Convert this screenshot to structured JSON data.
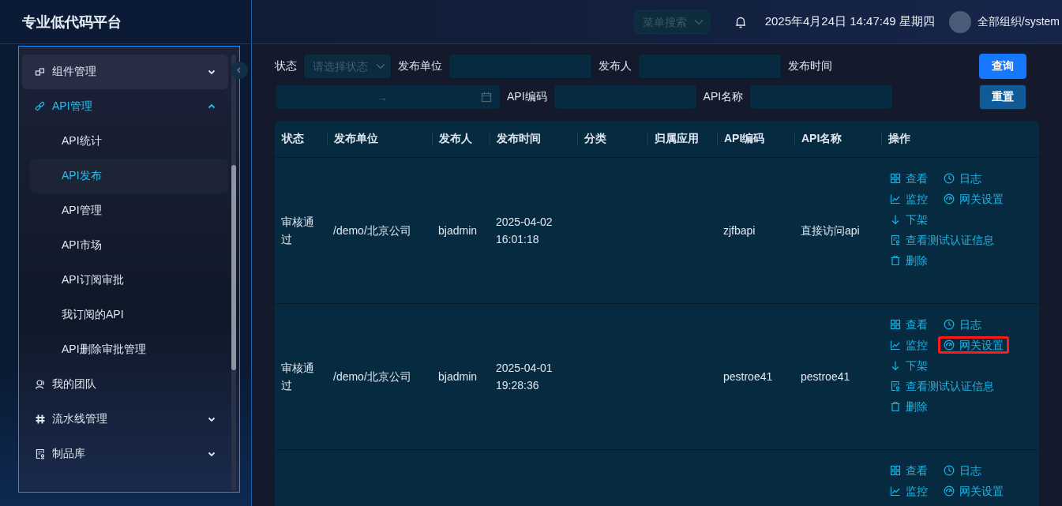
{
  "header": {
    "title": "专业低代码平台",
    "menu_search": {
      "placeholder": "菜单搜索"
    },
    "datetime": "2025年4月24日 14:47:49 星期四",
    "user": "全部组织/system"
  },
  "sidebar": {
    "items": [
      {
        "label": "组件管理",
        "kind": "group",
        "expanded": false,
        "selected": false
      },
      {
        "label": "API管理",
        "kind": "group",
        "expanded": true,
        "selected": true,
        "children": [
          {
            "label": "API统计",
            "selected": false
          },
          {
            "label": "API发布",
            "selected": true
          },
          {
            "label": "API管理",
            "selected": false
          },
          {
            "label": "API市场",
            "selected": false
          },
          {
            "label": "API订阅审批",
            "selected": false
          },
          {
            "label": "我订阅的API",
            "selected": false
          },
          {
            "label": "API删除审批管理",
            "selected": false
          }
        ]
      },
      {
        "label": "我的团队",
        "kind": "link",
        "selected": false
      },
      {
        "label": "流水线管理",
        "kind": "group",
        "expanded": false,
        "selected": false
      },
      {
        "label": "制品库",
        "kind": "group",
        "expanded": false,
        "selected": false
      }
    ]
  },
  "filters": [
    {
      "kind": "select",
      "label": "状态",
      "placeholder": "请选择状态"
    },
    {
      "kind": "input",
      "label": "发布单位"
    },
    {
      "kind": "input",
      "label": "发布人"
    },
    {
      "kind": "daterange",
      "label": "发布时间",
      "separator": "→"
    },
    {
      "kind": "input",
      "label": "API编码"
    },
    {
      "kind": "input",
      "label": "API名称"
    }
  ],
  "buttons": [
    {
      "label": "查询",
      "kind": "primary"
    },
    {
      "label": "重置",
      "kind": "secondary"
    }
  ],
  "table": {
    "columns": [
      "状态",
      "发布单位",
      "发布人",
      "发布时间",
      "分类",
      "归属应用",
      "API编码",
      "API名称",
      "操作"
    ],
    "rows": [
      {
        "cells": [
          "审核通过",
          "/demo/北京公司",
          "bjadmin",
          "2025-04-02 16:01:18",
          "",
          "",
          "zjfbapi",
          "直接访问api"
        ],
        "actions": [
          [
            {
              "kind": "view",
              "label": "查看",
              "highlighted": false
            },
            {
              "kind": "log",
              "label": "日志",
              "highlighted": false
            }
          ],
          [
            {
              "kind": "monitor",
              "label": "监控",
              "highlighted": false
            },
            {
              "kind": "gateway",
              "label": "网关设置",
              "highlighted": false
            }
          ],
          [
            {
              "kind": "offline",
              "label": "下架",
              "highlighted": false
            }
          ],
          [
            {
              "kind": "auth",
              "label": "查看测试认证信息",
              "highlighted": false
            }
          ],
          [
            {
              "kind": "delete",
              "label": "删除",
              "highlighted": false
            }
          ]
        ]
      },
      {
        "cells": [
          "审核通过",
          "/demo/北京公司",
          "bjadmin",
          "2025-04-01 19:28:36",
          "",
          "",
          "pestroe41",
          "pestroe41"
        ],
        "actions": [
          [
            {
              "kind": "view",
              "label": "查看",
              "highlighted": false
            },
            {
              "kind": "log",
              "label": "日志",
              "highlighted": false
            }
          ],
          [
            {
              "kind": "monitor",
              "label": "监控",
              "highlighted": false
            },
            {
              "kind": "gateway",
              "label": "网关设置",
              "highlighted": true
            }
          ],
          [
            {
              "kind": "offline",
              "label": "下架",
              "highlighted": false
            }
          ],
          [
            {
              "kind": "auth",
              "label": "查看测试认证信息",
              "highlighted": false
            }
          ],
          [
            {
              "kind": "delete",
              "label": "删除",
              "highlighted": false
            }
          ]
        ]
      },
      {
        "cells": [],
        "actions": [
          [
            {
              "kind": "view",
              "label": "查看",
              "highlighted": false
            },
            {
              "kind": "log",
              "label": "日志",
              "highlighted": false
            }
          ],
          [
            {
              "kind": "monitor",
              "label": "监控",
              "highlighted": false
            },
            {
              "kind": "gateway",
              "label": "网关设置",
              "highlighted": false
            }
          ]
        ]
      }
    ]
  }
}
